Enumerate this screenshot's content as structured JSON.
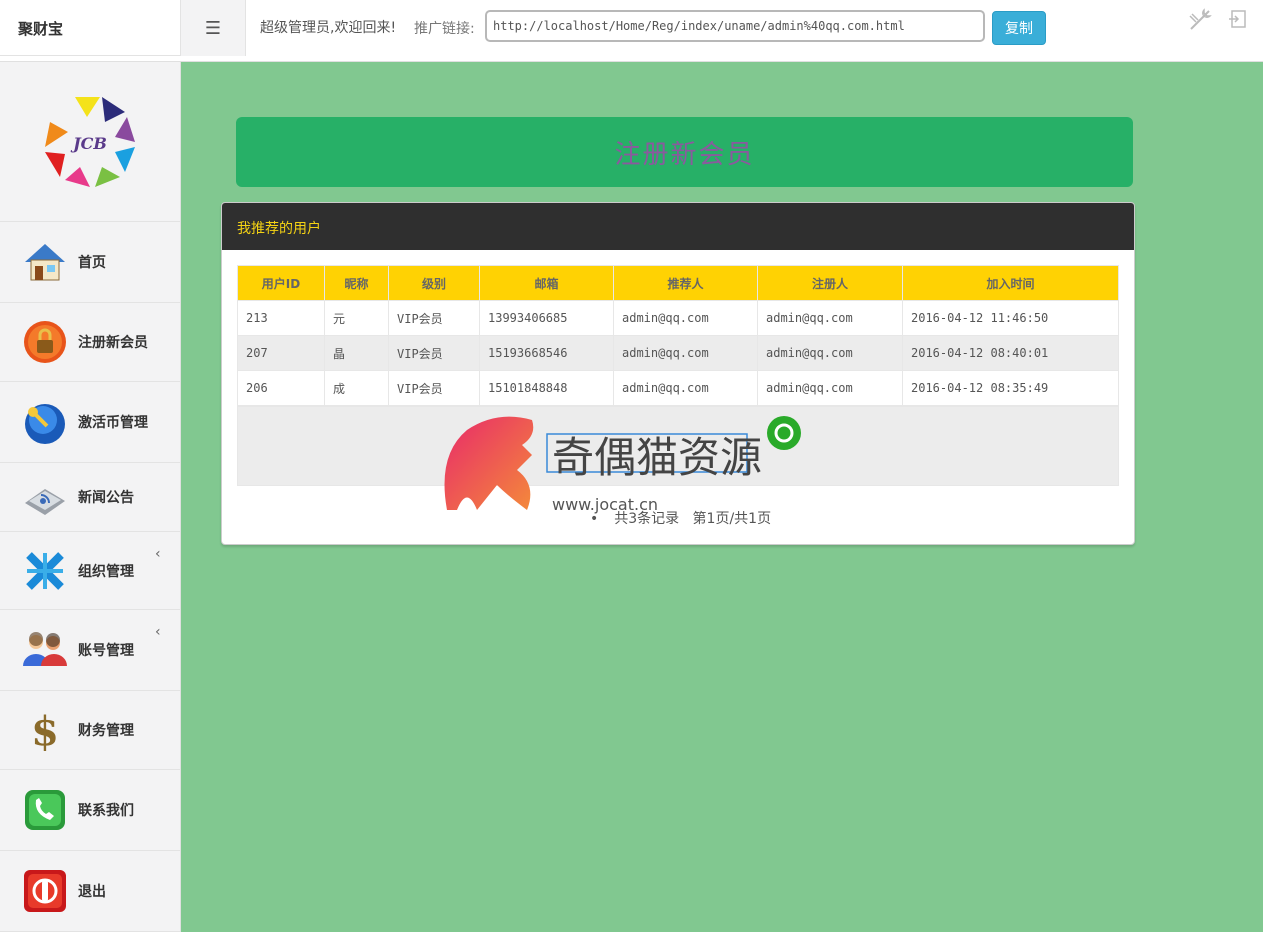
{
  "topbar": {
    "brand": "聚财宝",
    "menu_icon": "hamburger-icon",
    "welcome": "超级管理员,欢迎回来!",
    "promo_label": "推广链接:",
    "promo_url": "http://localhost/Home/Reg/index/uname/admin%40qq.com.html",
    "copy_label": "复制",
    "tools_icon": "tools-icon",
    "logout_icon": "logout-icon"
  },
  "sidebar": {
    "logo_text": "JCB",
    "items": [
      {
        "label": "首页",
        "icon": "house-icon"
      },
      {
        "label": "注册新会员",
        "icon": "lock-icon"
      },
      {
        "label": "激活币管理",
        "icon": "key-globe-icon"
      },
      {
        "label": "新闻公告",
        "icon": "rss-icon"
      },
      {
        "label": "组织管理",
        "icon": "network-icon",
        "caret": "‹"
      },
      {
        "label": "账号管理",
        "icon": "users-icon",
        "caret": "‹"
      },
      {
        "label": "财务管理",
        "icon": "dollar-icon"
      },
      {
        "label": "联系我们",
        "icon": "phone-icon"
      },
      {
        "label": "退出",
        "icon": "power-icon"
      }
    ]
  },
  "main": {
    "banner_title": "注册新会员",
    "panel_title": "我推荐的用户",
    "columns": [
      "用户ID",
      "昵称",
      "级别",
      "邮箱",
      "推荐人",
      "注册人",
      "加入时间"
    ],
    "rows": [
      [
        "213",
        "元",
        "VIP会员",
        "13993406685",
        "admin@qq.com",
        "admin@qq.com",
        "2016-04-12 11:46:50"
      ],
      [
        "207",
        "晶",
        "VIP会员",
        "15193668546",
        "admin@qq.com",
        "admin@qq.com",
        "2016-04-12 08:40:01"
      ],
      [
        "206",
        "成",
        "VIP会员",
        "15101848848",
        "admin@qq.com",
        "admin@qq.com",
        "2016-04-12 08:35:49"
      ]
    ],
    "pager_total": "共3条记录",
    "pager_pages": "第1页/共1页",
    "pager_bullet": "•"
  },
  "watermark": {
    "title": "奇偶猫资源",
    "url": "www.jocat.cn"
  }
}
